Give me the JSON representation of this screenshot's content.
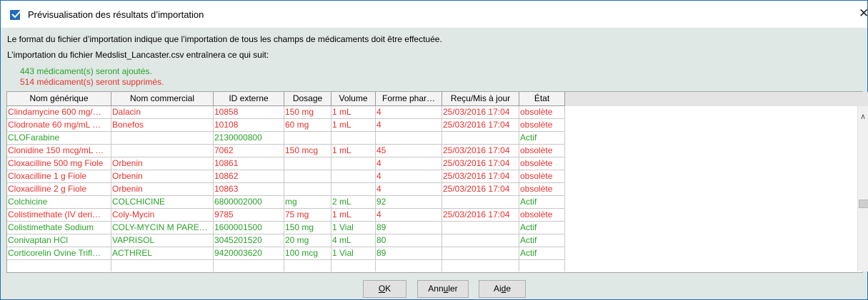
{
  "window": {
    "title": "Prévisualisation des résultats d’importation",
    "close_glyph": "✕"
  },
  "messages": {
    "line1": "Le format du fichier d’importation indique que l’importation de tous les champs de médicaments doit être effectuée.",
    "line2": "L’importation du fichier Medslist_Lancaster.csv entraînera ce qui suit:",
    "added": "443 médicament(s) seront ajoutés.",
    "removed": "514 médicament(s) seront supprimés."
  },
  "table": {
    "columns": [
      "Nom générique",
      "Nom commercial",
      "ID externe",
      "Dosage",
      "Volume",
      "Forme phar…",
      "Reçu/Mis à jour",
      "État"
    ],
    "rows": [
      {
        "status": "red",
        "cells": [
          "Clindamycine 600 mg/…",
          "Dalacin",
          "10858",
          "150 mg",
          "1 mL",
          "4",
          "25/03/2016 17:04",
          "obsolète"
        ]
      },
      {
        "status": "red",
        "cells": [
          "Clodronate 60 mg/mL …",
          "Bonefos",
          "10108",
          "60 mg",
          "1 mL",
          "4",
          "25/03/2016 17:04",
          "obsolète"
        ]
      },
      {
        "status": "green",
        "cells": [
          "CLOFarabine",
          "",
          "2130000800",
          "",
          "",
          "",
          "",
          "Actif"
        ]
      },
      {
        "status": "red",
        "cells": [
          "Clonidine 150 mcg/mL …",
          "",
          "7062",
          "150 mcg",
          "1 mL",
          "45",
          "25/03/2016 17:04",
          "obsolète"
        ]
      },
      {
        "status": "red",
        "cells": [
          "Cloxacilline  500 mg Fiole",
          "Orbenin",
          "10861",
          "",
          "",
          "4",
          "25/03/2016 17:04",
          "obsolète"
        ]
      },
      {
        "status": "red",
        "cells": [
          "Cloxacilline 1 g Fiole",
          "Orbenin",
          "10862",
          "",
          "",
          "4",
          "25/03/2016 17:04",
          "obsolète"
        ]
      },
      {
        "status": "red",
        "cells": [
          "Cloxacilline 2 g Fiole",
          "Orbenin",
          "10863",
          "",
          "",
          "4",
          "25/03/2016 17:04",
          "obsolète"
        ]
      },
      {
        "status": "green",
        "cells": [
          "Colchicine",
          "COLCHICINE",
          "6800002000",
          "mg",
          "2 mL",
          "92",
          "",
          "Actif"
        ]
      },
      {
        "status": "red",
        "cells": [
          "Colistimethate (IV deri…",
          "Coly-Mycin",
          "9785",
          "75 mg",
          "1 mL",
          "4",
          "25/03/2016 17:04",
          "obsolète"
        ]
      },
      {
        "status": "green",
        "cells": [
          "Colistimethate Sodium",
          "COLY-MYCIN M PARE…",
          "1600001500",
          "150 mg",
          "1 Vial",
          "89",
          "",
          "Actif"
        ]
      },
      {
        "status": "green",
        "cells": [
          "Conivaptan HCl",
          "VAPRISOL",
          "3045201520",
          "20 mg",
          "4 mL",
          "80",
          "",
          "Actif"
        ]
      },
      {
        "status": "green",
        "cells": [
          "Corticorelin Ovine Trifl…",
          "ACTHREL",
          "9420003620",
          "100 mcg",
          "1 Vial",
          "89",
          "",
          "Actif"
        ]
      },
      {
        "status": "green",
        "cells": [
          "",
          "",
          "",
          "",
          "",
          "",
          "",
          ""
        ]
      }
    ]
  },
  "buttons": {
    "ok": {
      "pre": "",
      "key": "O",
      "post": "K"
    },
    "cancel": {
      "pre": "Ann",
      "key": "u",
      "post": "ler"
    },
    "help": {
      "pre": "Ai",
      "key": "d",
      "post": "e"
    }
  },
  "colors": {
    "added": "#2aa22a",
    "removed": "#e6312e",
    "title_check": "#1f6bbf"
  },
  "icons": {
    "title": "checkbox-checked-icon",
    "close": "close-icon",
    "scroll_up": "chevron-up-icon"
  }
}
